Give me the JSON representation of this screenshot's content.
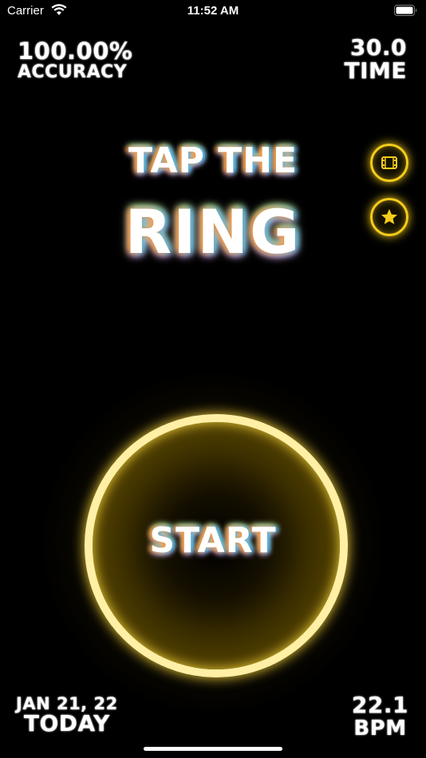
{
  "status_bar": {
    "carrier": "Carrier",
    "time": "11:52 AM"
  },
  "stats": {
    "accuracy_value": "100.00%",
    "accuracy_label": "ACCURACY",
    "time_value": "30.0",
    "time_label": "TIME",
    "date_value": "JAN 21, 22",
    "date_label": "TODAY",
    "bpm_value": "22.1",
    "bpm_label": "BPM"
  },
  "title": {
    "line1": "TAP THE",
    "line2": "RING"
  },
  "side_buttons": {
    "film_icon": "film-icon",
    "star_icon": "star-icon"
  },
  "ring": {
    "label": "START"
  },
  "colors": {
    "accent": "#f5cc1a",
    "ring": "#fff0a6",
    "background": "#000000"
  }
}
